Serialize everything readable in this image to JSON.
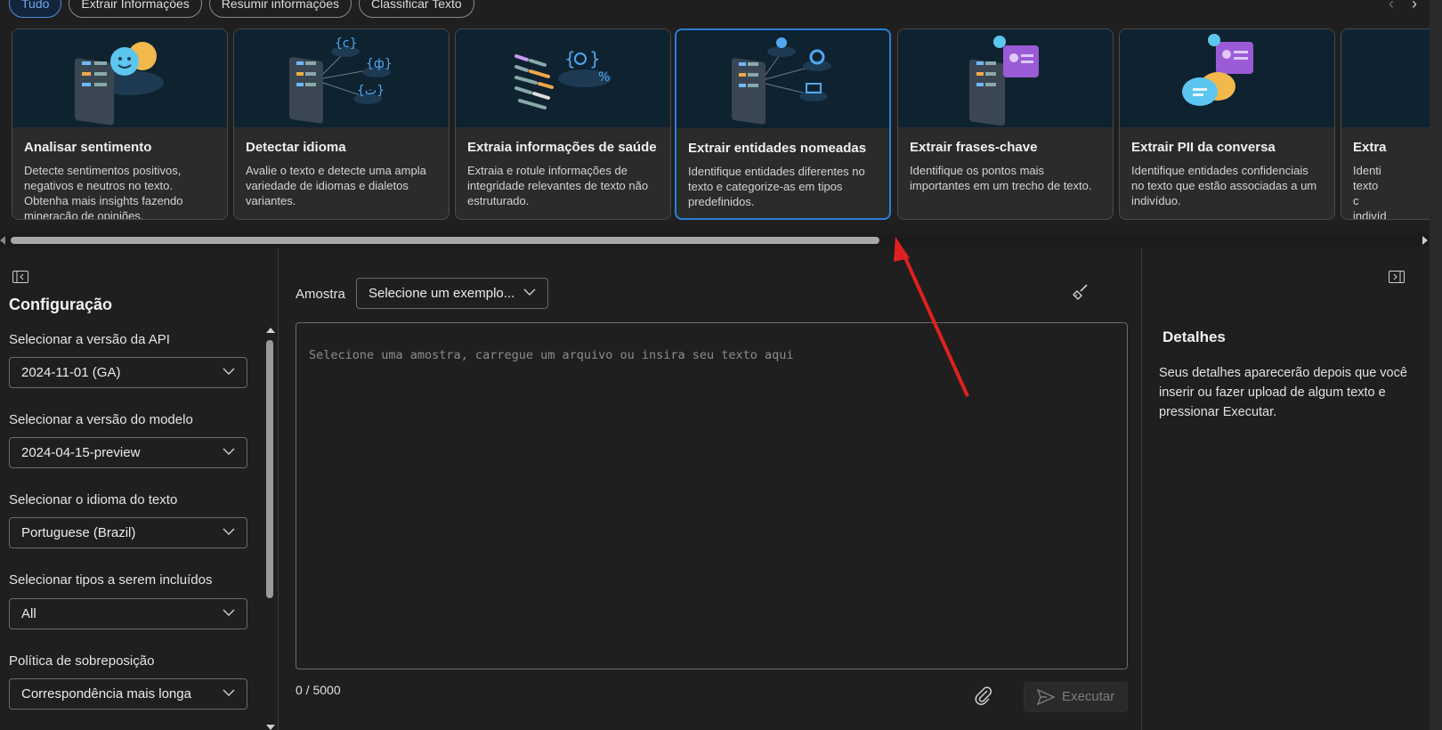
{
  "filters": [
    "Tudo",
    "Extrair Informações",
    "Resumir informações",
    "Classificar Texto"
  ],
  "cards": [
    {
      "title": "Analisar sentimento",
      "description": "Detecte sentimentos positivos, negativos e neutros no texto. Obtenha mais insights fazendo mineração de opiniões."
    },
    {
      "title": "Detectar idioma",
      "description": "Avalie o texto e detecte uma ampla variedade de idiomas e dialetos variantes."
    },
    {
      "title": "Extraia informações de saúde",
      "description": "Extraia e rotule informações de integridade relevantes de texto não estruturado."
    },
    {
      "title": "Extrair entidades nomeadas",
      "description": "Identifique entidades diferentes no texto e categorize-as em tipos predefinidos."
    },
    {
      "title": "Extrair frases-chave",
      "description": "Identifique os pontos mais importantes em um trecho de texto."
    },
    {
      "title": "Extrair PII da conversa",
      "description": "Identifique entidades confidenciais no texto que estão associadas a um indivíduo."
    },
    {
      "title": "Extra",
      "description": "Identi texto c indivíd"
    }
  ],
  "config": {
    "title": "Configuração",
    "fields": [
      {
        "label": "Selecionar a versão da API",
        "value": "2024-11-01 (GA)"
      },
      {
        "label": "Selecionar a versão do modelo",
        "value": "2024-04-15-preview"
      },
      {
        "label": "Selecionar o idioma do texto",
        "value": "Portuguese (Brazil)"
      },
      {
        "label": "Selecionar tipos a serem incluídos",
        "value": "All"
      },
      {
        "label": "Política de sobreposição",
        "value": "Correspondência mais longa"
      }
    ]
  },
  "input": {
    "sample_label": "Amostra",
    "sample_value": "Selecione um exemplo...",
    "placeholder": "Selecione uma amostra, carregue um arquivo ou insira seu texto aqui",
    "counter": "0 / 5000",
    "run_label": "Executar"
  },
  "details": {
    "title": "Detalhes",
    "text": "Seus detalhes aparecerão depois que você inserir ou fazer upload de algum texto e pressionar Executar."
  },
  "colors": {
    "accent": "#2b7fd9",
    "annotation": "#e02020"
  }
}
